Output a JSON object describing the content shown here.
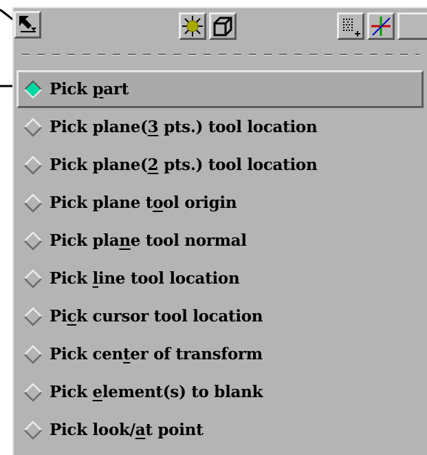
{
  "toolbar": {
    "buttons": [
      {
        "name": "pick-mode-dropdown",
        "icon": "pick-cursor-icon"
      },
      {
        "name": "light-source",
        "icon": "light-source-icon"
      },
      {
        "name": "box-view",
        "icon": "box-outline-icon"
      },
      {
        "name": "grid-select",
        "icon": "grid-select-icon"
      },
      {
        "name": "axis-triad",
        "icon": "axis-triad-icon"
      }
    ],
    "colors": {
      "sun": "#a8a800",
      "axis_red": "#d00000",
      "axis_green": "#00a000",
      "axis_blue": "#0000d0"
    }
  },
  "menu": {
    "selected_color": "#00d8a0",
    "items": [
      {
        "before": "Pick ",
        "mnemonic": "p",
        "after": "art",
        "selected": true
      },
      {
        "before": "Pick plane(",
        "mnemonic": "3",
        "after": " pts.) tool location",
        "selected": false
      },
      {
        "before": "Pick plane(",
        "mnemonic": "2",
        "after": " pts.) tool location",
        "selected": false
      },
      {
        "before": "Pick plane t",
        "mnemonic": "o",
        "after": "ol origin",
        "selected": false
      },
      {
        "before": "Pick pla",
        "mnemonic": "n",
        "after": "e tool normal",
        "selected": false
      },
      {
        "before": "Pick ",
        "mnemonic": "l",
        "after": "ine tool location",
        "selected": false
      },
      {
        "before": "Pi",
        "mnemonic": "c",
        "after": "k cursor tool location",
        "selected": false
      },
      {
        "before": "Pick cen",
        "mnemonic": "t",
        "after": "er of transform",
        "selected": false
      },
      {
        "before": "Pick ",
        "mnemonic": "e",
        "after": "lement(s) to blank",
        "selected": false
      },
      {
        "before": "Pick look/",
        "mnemonic": "a",
        "after": "t point",
        "selected": false
      }
    ]
  }
}
